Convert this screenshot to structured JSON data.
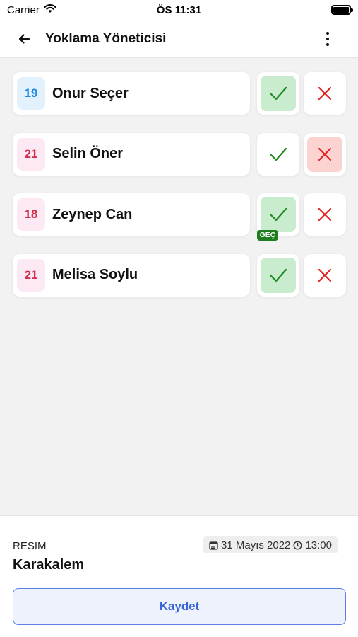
{
  "status_bar": {
    "carrier": "Carrier",
    "time": "ÖS 11:31"
  },
  "header": {
    "title": "Yoklama Yöneticisi"
  },
  "students": [
    {
      "number": "19",
      "name": "Onur Seçer",
      "badge_color": "blue",
      "present": true,
      "absent": false,
      "late_label": ""
    },
    {
      "number": "21",
      "name": "Selin Öner",
      "badge_color": "pink",
      "present": false,
      "absent": true,
      "late_label": ""
    },
    {
      "number": "18",
      "name": "Zeynep Can",
      "badge_color": "pink",
      "present": true,
      "absent": false,
      "late_label": "GEÇ"
    },
    {
      "number": "21",
      "name": "Melisa Soylu",
      "badge_color": "pink",
      "present": true,
      "absent": false,
      "late_label": ""
    }
  ],
  "footer": {
    "course_label": "RESIM",
    "course_title": "Karakalem",
    "date": "31 Mayıs 2022",
    "time": "13:00",
    "save_label": "Kaydet"
  },
  "colors": {
    "present_check": "#1f8a1f",
    "absent_x": "#e02424",
    "accent": "#3a64d8"
  }
}
